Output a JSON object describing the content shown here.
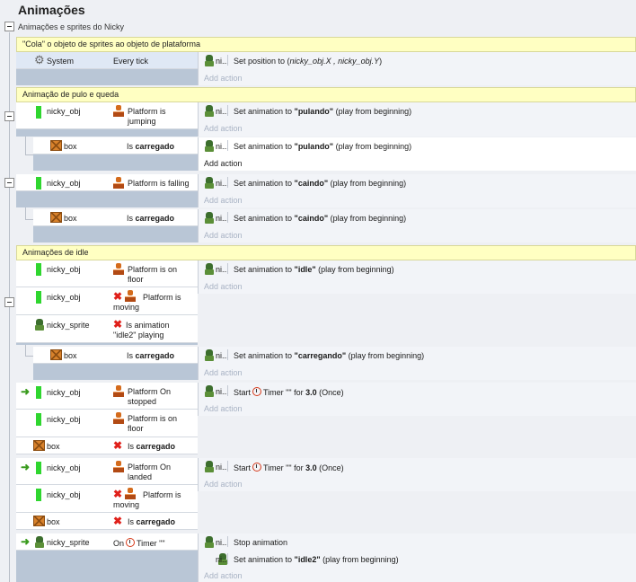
{
  "header": {
    "title": "Animações",
    "subtitle": "Animações e sprites do Nicky"
  },
  "ui": {
    "add_action": "Add action",
    "ni": "ni..."
  },
  "comments": {
    "c1": "\"Cola\" o objeto de sprites ao objeto de plataforma",
    "c2": "Animação de pulo e queda",
    "c3": "Animações de idle"
  },
  "events": {
    "e1": {
      "obj": "System",
      "cond": "Every tick",
      "act_prefix": "Set position to (",
      "act_italic": "nicky_obj.X , nicky_obj.Y",
      "act_suffix": ")"
    },
    "e2": {
      "obj": "nicky_obj",
      "cond": "Platform is jumping",
      "act_prefix": "Set animation to ",
      "act_bold": "\"pulando\"",
      "act_suffix": " (play from beginning)"
    },
    "e2s": {
      "obj": "box",
      "cond_prefix": "Is ",
      "cond_bold": "carregado",
      "act_prefix": "Set animation to ",
      "act_bold": "\"pulando\"",
      "act_suffix": " (play from beginning)"
    },
    "e3": {
      "obj": "nicky_obj",
      "cond": "Platform is falling",
      "act_prefix": "Set animation to ",
      "act_bold": "\"caindo\"",
      "act_suffix": " (play from beginning)"
    },
    "e3s": {
      "obj": "box",
      "cond_prefix": "Is ",
      "cond_bold": "carregado",
      "act_prefix": "Set animation to ",
      "act_bold": "\"caindo\"",
      "act_suffix": " (play from beginning)"
    },
    "e4": {
      "c1_obj": "nicky_obj",
      "c1": "Platform is on floor",
      "c2_obj": "nicky_obj",
      "c2": "Platform is moving",
      "c3_obj": "nicky_sprite",
      "c3": "Is animation \"idle2\" playing",
      "act_prefix": "Set animation to ",
      "act_bold": "\"idle\"",
      "act_suffix": " (play from beginning)"
    },
    "e4s": {
      "obj": "box",
      "cond_prefix": "Is ",
      "cond_bold": "carregado",
      "act_prefix": "Set animation to ",
      "act_bold": "\"carregando\"",
      "act_suffix": " (play from beginning)"
    },
    "e5": {
      "c1_obj": "nicky_obj",
      "c1": "Platform On stopped",
      "c2_obj": "nicky_obj",
      "c2": "Platform is on floor",
      "c3_obj": "box",
      "c3_prefix": "Is ",
      "c3_bold": "carregado",
      "act_prefix": "Start",
      "act_mid": "Timer \"\" for ",
      "act_bold": "3.0",
      "act_suffix": " (Once)"
    },
    "e6": {
      "c1_obj": "nicky_obj",
      "c1": "Platform On landed",
      "c2_obj": "nicky_obj",
      "c2": "Platform is moving",
      "c3_obj": "box",
      "c3_prefix": "Is ",
      "c3_bold": "carregado",
      "act_prefix": "Start",
      "act_mid": "Timer \"\" for ",
      "act_bold": "3.0",
      "act_suffix": " (Once)"
    },
    "e7": {
      "obj": "nicky_sprite",
      "cond_prefix": "On",
      "cond_suffix": "Timer \"\"",
      "act1": "Stop animation",
      "act2_prefix": "Set animation to ",
      "act2_bold": "\"idle2\"",
      "act2_suffix": " (play from beginning)"
    }
  },
  "icons": [
    "collapse-icon",
    "gear-icon",
    "green-object-icon",
    "box-icon",
    "sprite-icon",
    "platform-icon",
    "not-icon",
    "trigger-arrow-icon",
    "timer-icon"
  ]
}
